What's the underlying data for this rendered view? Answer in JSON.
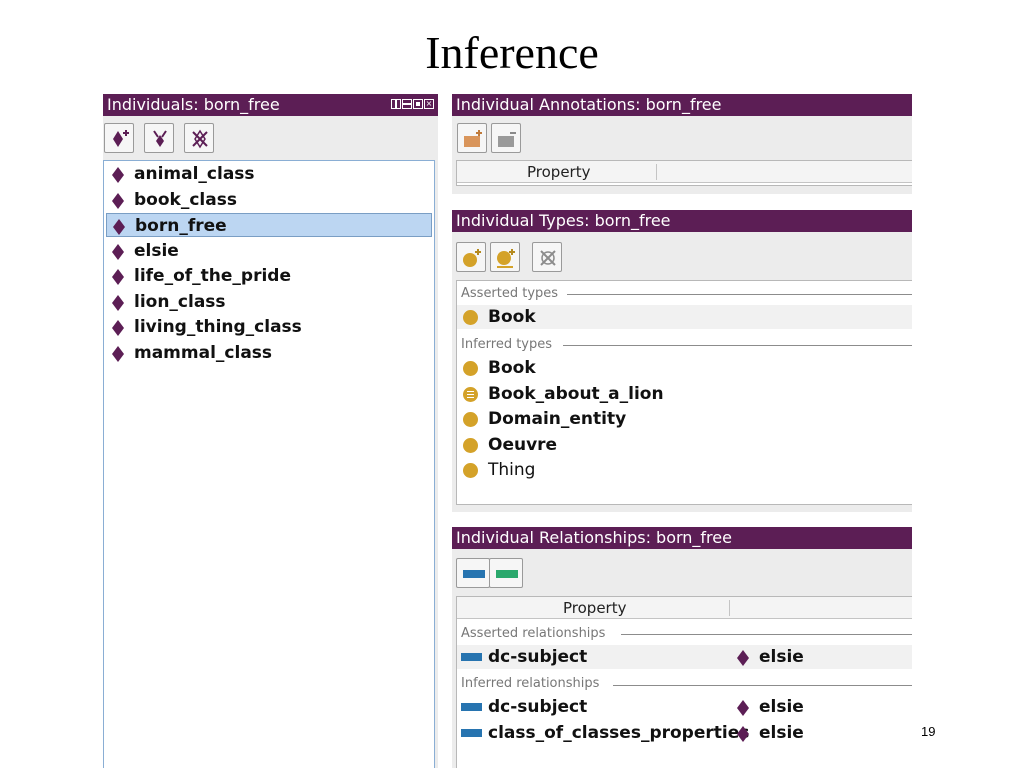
{
  "slide": {
    "title": "Inference",
    "page_number": "19"
  },
  "individuals_panel": {
    "title": "Individuals: born_free",
    "items": [
      {
        "label": "animal_class"
      },
      {
        "label": "book_class"
      },
      {
        "label": "born_free",
        "selected": true
      },
      {
        "label": "elsie"
      },
      {
        "label": "life_of_the_pride"
      },
      {
        "label": "lion_class"
      },
      {
        "label": "living_thing_class"
      },
      {
        "label": "mammal_class"
      }
    ]
  },
  "annotations_panel": {
    "title": "Individual Annotations: born_free",
    "column_property": "Property"
  },
  "types_panel": {
    "title": "Individual Types: born_free",
    "asserted_label": "Asserted types",
    "asserted": [
      {
        "label": "Book",
        "icon": "class-icon"
      }
    ],
    "inferred_label": "Inferred types",
    "inferred": [
      {
        "label": "Book",
        "icon": "class-icon"
      },
      {
        "label": "Book_about_a_lion",
        "icon": "defined-class-icon"
      },
      {
        "label": "Domain_entity",
        "icon": "class-icon"
      },
      {
        "label": "Oeuvre",
        "icon": "class-icon"
      },
      {
        "label": "Thing",
        "icon": "class-icon"
      }
    ]
  },
  "relationships_panel": {
    "title": "Individual Relationships: born_free",
    "column_property": "Property",
    "asserted_label": "Asserted relationships",
    "asserted": [
      {
        "property": "dc-subject",
        "value": "elsie"
      }
    ],
    "inferred_label": "Inferred relationships",
    "inferred": [
      {
        "property": "dc-subject",
        "value": "elsie"
      },
      {
        "property": "class_of_classes_properties",
        "value": "elsie"
      }
    ]
  },
  "colors": {
    "titlebar": "#5c1e55",
    "individual_diamond": "#5c1e55",
    "class_circle": "#d4a229",
    "object_property": "#2774b0",
    "data_property": "#2aa86c",
    "selection": "#bcd6f2"
  }
}
